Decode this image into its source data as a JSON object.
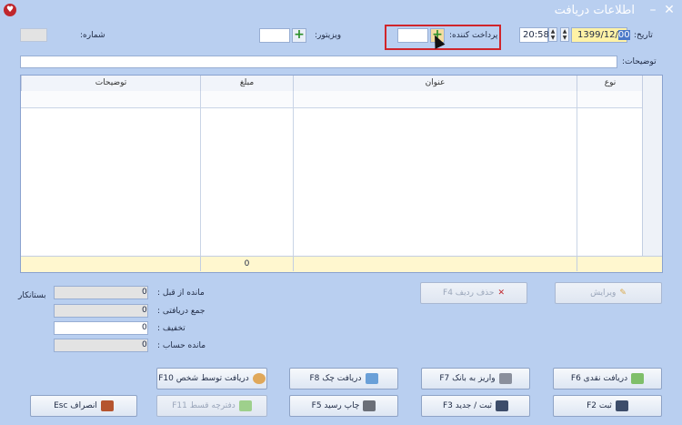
{
  "window": {
    "title": "اطلاعات دریافت"
  },
  "header": {
    "number_label": "شماره:",
    "visitor_label": "ویزیتور:",
    "payer_label": "پرداخت کننده:",
    "date_label": "تاریخ:",
    "date_prefix": "1399/12/",
    "date_selected": "",
    "time_value": "20:58",
    "description_label": "توضیحات:"
  },
  "grid": {
    "columns": [
      "نوع",
      "عنوان",
      "مبلغ",
      "توضیحات"
    ],
    "footer_amount": "0"
  },
  "actions": {
    "edit": "ویرایش",
    "delete_row": "حذف ردیف F4"
  },
  "summary": {
    "creditor_label": "بستانکار",
    "rows": [
      {
        "label": "مانده از قبل :",
        "value": "0"
      },
      {
        "label": "جمع دریافتی :",
        "value": "0"
      },
      {
        "label": "تخفیف :",
        "value": "0"
      },
      {
        "label": "مانده حساب :",
        "value": "0"
      }
    ]
  },
  "buttons": {
    "cash_receipt": "دریافت نقدی F6",
    "bank_deposit": "واریز به بانک F7",
    "check_receipt": "دریافت چک F8",
    "receive_by_person": "دریافت توسط شخص F10",
    "save": "ثبت F2",
    "save_new": "ثبت / جدید F3",
    "print_receipt": "چاپ رسید F5",
    "installment_book": "دفترچه قسط F11",
    "cancel": "انصراف Esc"
  }
}
